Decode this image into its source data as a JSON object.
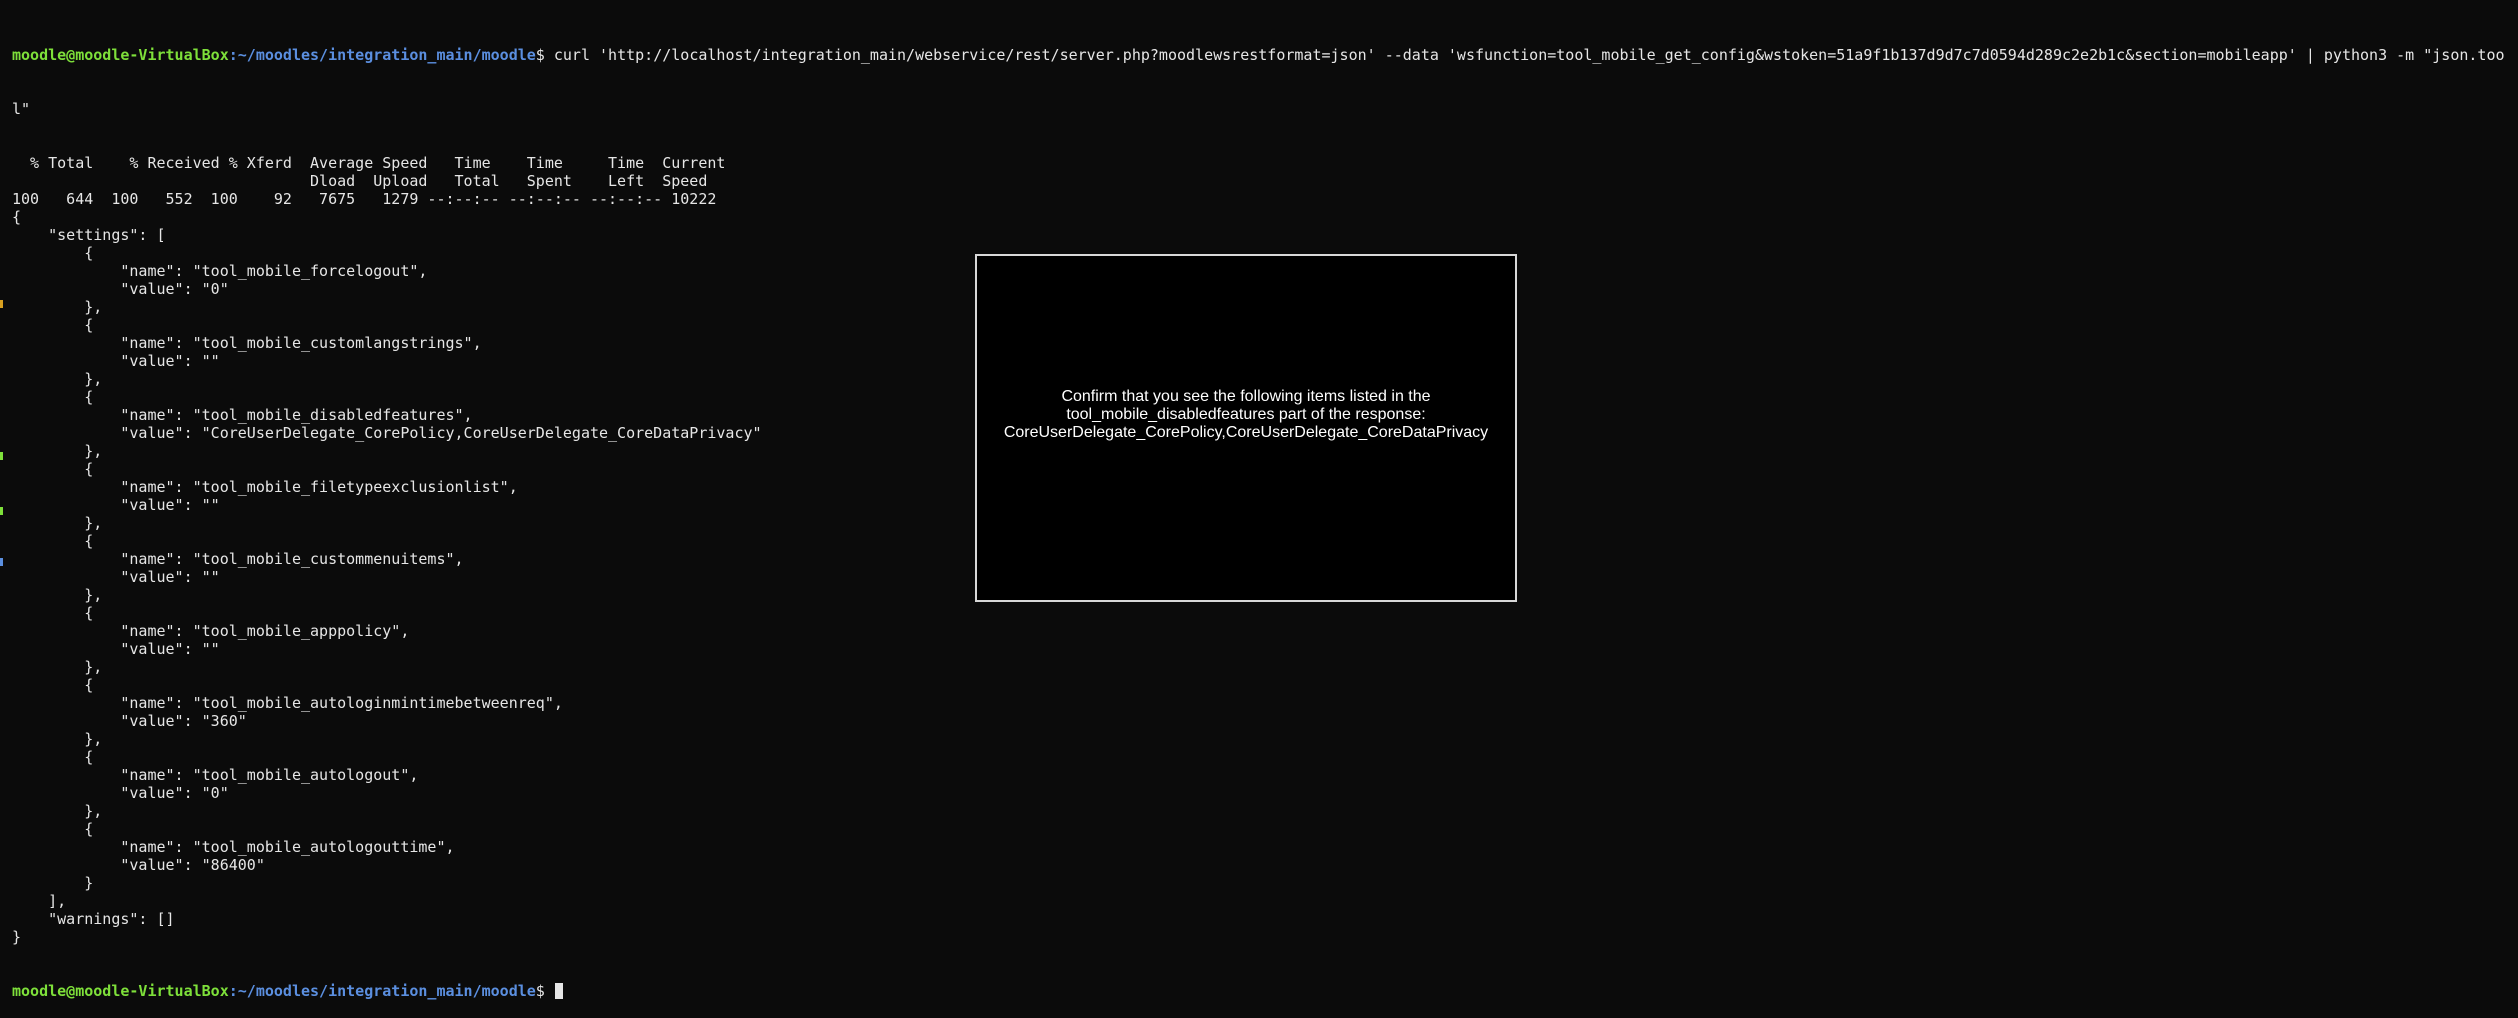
{
  "prompt": {
    "user_host": "moodle@moodle-VirtualBox",
    "path": ":~/moodles/integration_main/moodle",
    "symbol": "$ "
  },
  "terminal": {
    "command_line_1": "curl 'http://localhost/integration_main/webservice/rest/server.php?moodlewsrestformat=json' --data 'wsfunction=tool_mobile_get_config&wstoken=51a9f1b137d9d7c7d0594d289c2e2b1c&section=mobileapp' | python3 -m \"json.too",
    "command_line_2": "l\"",
    "output_lines": [
      "  % Total    % Received % Xferd  Average Speed   Time    Time     Time  Current",
      "                                 Dload  Upload   Total   Spent    Left  Speed",
      "100   644  100   552  100    92   7675   1279 --:--:-- --:--:-- --:--:-- 10222",
      "{",
      "    \"settings\": [",
      "        {",
      "            \"name\": \"tool_mobile_forcelogout\",",
      "            \"value\": \"0\"",
      "        },",
      "        {",
      "            \"name\": \"tool_mobile_customlangstrings\",",
      "            \"value\": \"\"",
      "        },",
      "        {",
      "            \"name\": \"tool_mobile_disabledfeatures\",",
      "            \"value\": \"CoreUserDelegate_CorePolicy,CoreUserDelegate_CoreDataPrivacy\"",
      "        },",
      "        {",
      "            \"name\": \"tool_mobile_filetypeexclusionlist\",",
      "            \"value\": \"\"",
      "        },",
      "        {",
      "            \"name\": \"tool_mobile_custommenuitems\",",
      "            \"value\": \"\"",
      "        },",
      "        {",
      "            \"name\": \"tool_mobile_apppolicy\",",
      "            \"value\": \"\"",
      "        },",
      "        {",
      "            \"name\": \"tool_mobile_autologinmintimebetweenreq\",",
      "            \"value\": \"360\"",
      "        },",
      "        {",
      "            \"name\": \"tool_mobile_autologout\",",
      "            \"value\": \"0\"",
      "        },",
      "        {",
      "            \"name\": \"tool_mobile_autologouttime\",",
      "            \"value\": \"86400\"",
      "        }",
      "    ],",
      "    \"warnings\": []",
      "}"
    ]
  },
  "dialog": {
    "text": "Confirm that you see the following items listed in the\ntool_mobile_disabledfeatures part of the response:\nCoreUserDelegate_CorePolicy,CoreUserDelegate_CoreDataPrivacy"
  },
  "colors": {
    "background": "#0b0b0b",
    "text": "#e6e6e6",
    "prompt_user": "#7ee03a",
    "prompt_path": "#5b8fe0"
  }
}
